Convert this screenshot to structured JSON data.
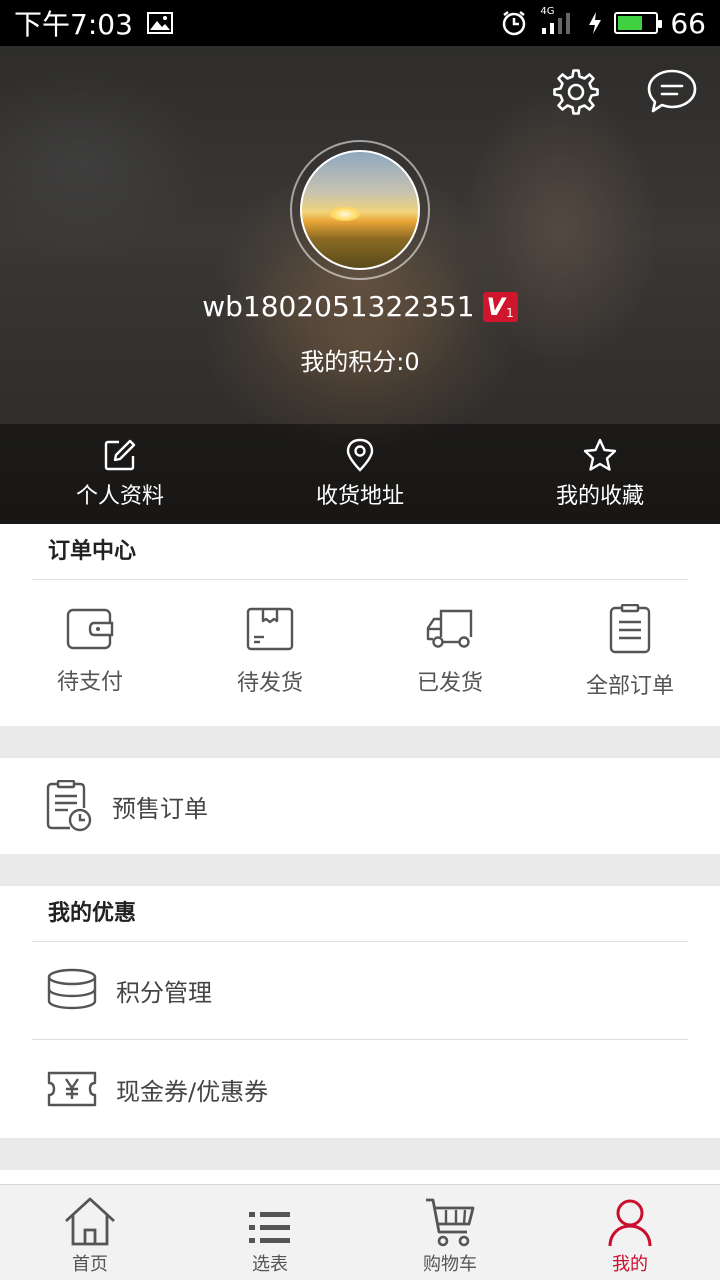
{
  "status_bar": {
    "time": "下午7:03",
    "network": "4G",
    "battery": "66",
    "battery_level": 0.66,
    "battery_color": "#3fd13f"
  },
  "profile": {
    "username": "wb1802051322351",
    "vip_letter": "V",
    "vip_level": "1",
    "points": "我的积分:0",
    "vip_color": "#d0162c"
  },
  "quick_actions": [
    {
      "label": "个人资料",
      "icon": "edit-icon"
    },
    {
      "label": "收货地址",
      "icon": "location-pin-icon"
    },
    {
      "label": "我的收藏",
      "icon": "star-icon"
    }
  ],
  "order_center": {
    "title": "订单中心",
    "items": [
      {
        "label": "待支付",
        "icon": "wallet-icon"
      },
      {
        "label": "待发货",
        "icon": "package-icon"
      },
      {
        "label": "已发货",
        "icon": "truck-icon"
      },
      {
        "label": "全部订单",
        "icon": "clipboard-icon"
      }
    ]
  },
  "presale": {
    "label": "预售订单",
    "icon": "clipboard-clock-icon"
  },
  "discounts": {
    "title": "我的优惠",
    "items": [
      {
        "label": "积分管理",
        "icon": "coin-stack-icon"
      },
      {
        "label": "现金券/优惠券",
        "icon": "yen-ticket-icon"
      }
    ]
  },
  "bottom_nav": {
    "items": [
      {
        "label": "首页",
        "icon": "home-icon"
      },
      {
        "label": "选表",
        "icon": "list-icon"
      },
      {
        "label": "购物车",
        "icon": "cart-icon"
      },
      {
        "label": "我的",
        "icon": "user-icon"
      }
    ],
    "active_index": 3,
    "active_color": "#c8102e"
  }
}
